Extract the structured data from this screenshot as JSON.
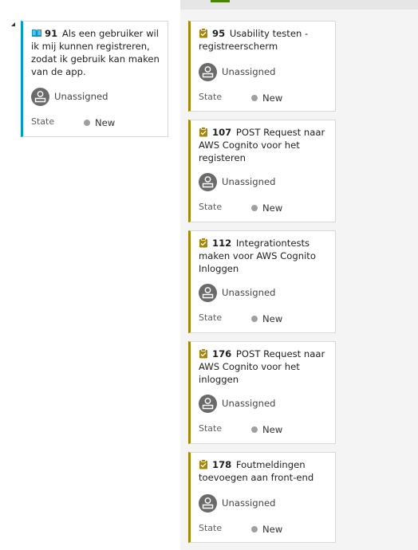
{
  "story": {
    "id": "91",
    "title": "Als een gebruiker wil ik mij kunnen registreren, zodat ik gebruik kan maken van de app.",
    "assignee": "Unassigned",
    "state_label": "State",
    "state_value": "New",
    "icon": "book-icon"
  },
  "tasks": [
    {
      "id": "95",
      "title": "Usability testen - registreerscherm",
      "assignee": "Unassigned",
      "state_label": "State",
      "state_value": "New",
      "icon": "clipboard-icon"
    },
    {
      "id": "107",
      "title": "POST Request naar AWS Cognito voor het registeren",
      "assignee": "Unassigned",
      "state_label": "State",
      "state_value": "New",
      "icon": "clipboard-icon"
    },
    {
      "id": "112",
      "title": "Integrationtests maken voor AWS Cognito Inloggen",
      "assignee": "Unassigned",
      "state_label": "State",
      "state_value": "New",
      "icon": "clipboard-icon"
    },
    {
      "id": "176",
      "title": "POST Request naar AWS Cognito voor het inloggen",
      "assignee": "Unassigned",
      "state_label": "State",
      "state_value": "New",
      "icon": "clipboard-icon"
    },
    {
      "id": "178",
      "title": "Foutmeldingen toevoegen aan front-end",
      "assignee": "Unassigned",
      "state_label": "State",
      "state_value": "New",
      "icon": "clipboard-icon"
    }
  ],
  "colors": {
    "story_accent": "#009ccc",
    "task_accent": "#a4880a",
    "state_new": "#a0a0a0"
  }
}
